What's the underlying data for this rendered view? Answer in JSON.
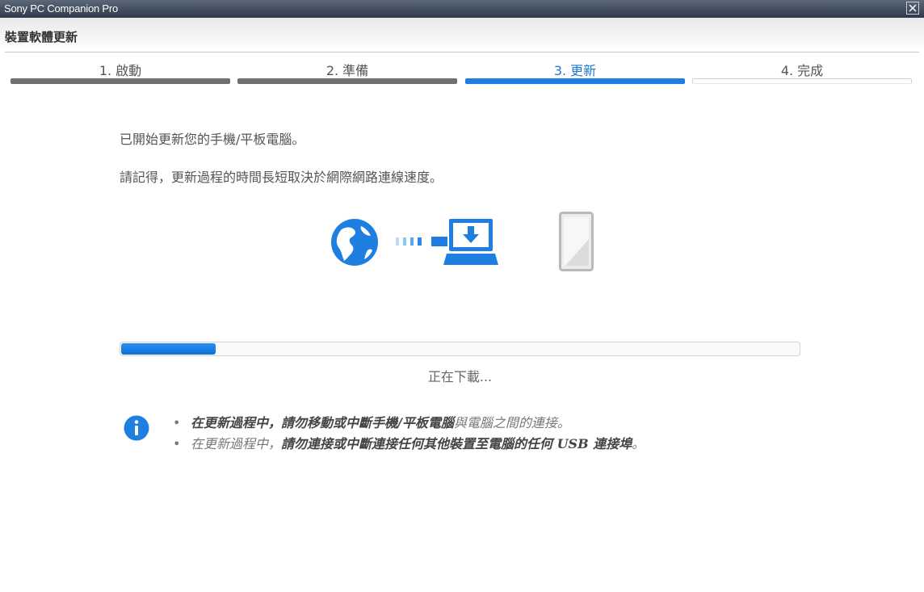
{
  "window": {
    "title": "Sony PC Companion Pro",
    "close_icon": "close-icon"
  },
  "header": {
    "title": "裝置軟體更新"
  },
  "steps": [
    {
      "label": "1. 啟動",
      "state": "done"
    },
    {
      "label": "2. 準備",
      "state": "done"
    },
    {
      "label": "3. 更新",
      "state": "active"
    },
    {
      "label": "4. 完成",
      "state": "pending"
    }
  ],
  "main": {
    "intro_line1": "已開始更新您的手機/平板電腦。",
    "intro_line2": "請記得，更新過程的時間長短取決於網際網路連線速度。",
    "illustration_icons": [
      "globe-icon",
      "laptop-download-icon",
      "phone-icon"
    ],
    "progress": {
      "fraction": 0.14
    },
    "status": "正在下載..."
  },
  "notes": [
    {
      "bold": "在更新過程中，請勿移動或中斷手機/平板電腦",
      "normal": "與電腦之間的連接。"
    },
    {
      "normal": "在更新過程中，",
      "bold": "請勿連接或中斷連接任何其他裝置至電腦的任何 USB 連接埠",
      "tail": "。"
    }
  ],
  "colors": {
    "accent": "#1e7fe0",
    "done_bar": "#707070",
    "text": "#555555"
  }
}
